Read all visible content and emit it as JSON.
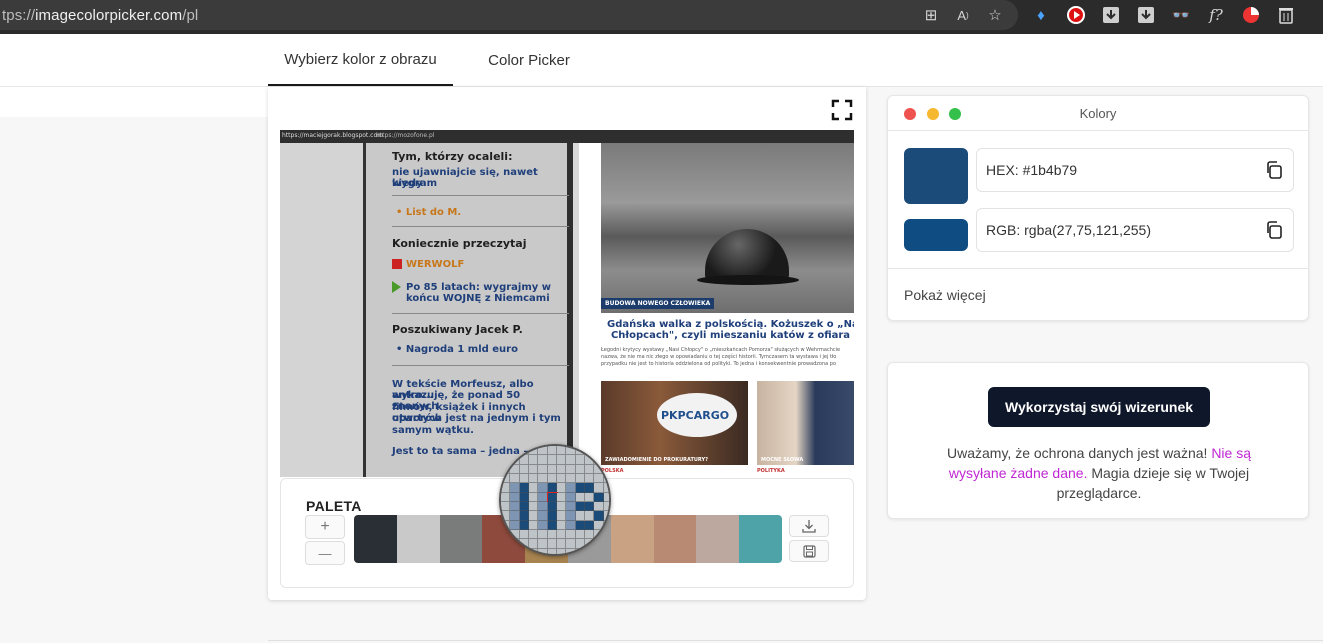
{
  "browser": {
    "url_prefix": "tps://",
    "url_host": "imagecolorpicker.com",
    "url_path": "/pl"
  },
  "tabs": [
    {
      "label": "Wybierz kolor z obrazu",
      "active": true
    },
    {
      "label": "Color Picker",
      "active": false
    }
  ],
  "screenshot": {
    "url_left": "https://maciejgorak.blogspot.com",
    "url_right": "https://mozofone.pl",
    "sidebar": {
      "h1": "Tym, którzy ocaleli:",
      "t1a": "nie ujawniajcie się, nawet kiedy",
      "t1b": "wygram",
      "list1": "• List do M.",
      "h2": "Koniecznie przeczytaj",
      "werwolf": "WERWOLF",
      "t2a": "Po 85 latach: wygrajmy w",
      "t2b": "końcu WOJNĘ z Niemcami",
      "h3": "Poszukiwany Jacek P.",
      "reward": "• Nagroda 1 mld euro",
      "p1": "W tekście Morfeusz, albo antro...",
      "p2": "wykazuję, że ponad 50 znanych",
      "p3": "filmów, książek i innych utworów",
      "p4": "opartych jest na jednym i tym",
      "p5": "samym wątku.",
      "p6": "Jest to ta sama – jedna –"
    },
    "news": {
      "photo_tag": "BUDOWA NOWEGO CZŁOWIEKA",
      "title1": "Gdańska walka z polskością. Kożuszek o „Nas",
      "title2": "Chłopcach\", czyli mieszaniu katów z ofiara",
      "body": "Łegodni krytycy wystawy „Nasi Chłopcy\" o „mieszkańcach Pomorza\" służących w Wehrmachcie nazwa, że nie ma nic złego w opowiadaniu o tej części historii. Tymczasem ta wystawa i jej tło przypadku nie jest to historia oddzielona od polityki. To jedna i konsekwentnie prowadzona po",
      "thumb1_logo": "PKPCARGO",
      "thumb1_cap": "ZAWIADOMIENIE DO PROKURATURY?",
      "thumb2_cap": "MOCNE SŁOWA",
      "cat1": "POLSKA",
      "cat2": "POLITYKA"
    }
  },
  "palette": {
    "title": "PALETA",
    "add_label": "+",
    "remove_label": "—",
    "swatches": [
      "#2a2f36",
      "#c9c9c9",
      "#7a7c7c",
      "#8e4a3c",
      "#a7834f",
      "#9a9a9a",
      "#c9a284",
      "#b88a73",
      "#bda8a0",
      "#4ea3a8"
    ]
  },
  "colors_panel": {
    "title": "Kolory",
    "hex_label": "HEX:  #1b4b79",
    "rgb_label": "RGB:  rgba(27,75,121,255)",
    "swatch_hex": "#1b4b79",
    "swatch_rgb": "#0f4c81",
    "show_more": "Pokaż więcej"
  },
  "promo": {
    "button_label": "Wykorzystaj swój wizerunek",
    "text_a": "Uważamy, że ochrona danych jest ważna!",
    "text_link": "Nie są wysyłane żadne dane.",
    "text_b": "Magia dzieje się w Twojej przeglądarce."
  },
  "colors": {
    "accent_pink": "#c026d3",
    "button_dark": "#0f172a"
  }
}
